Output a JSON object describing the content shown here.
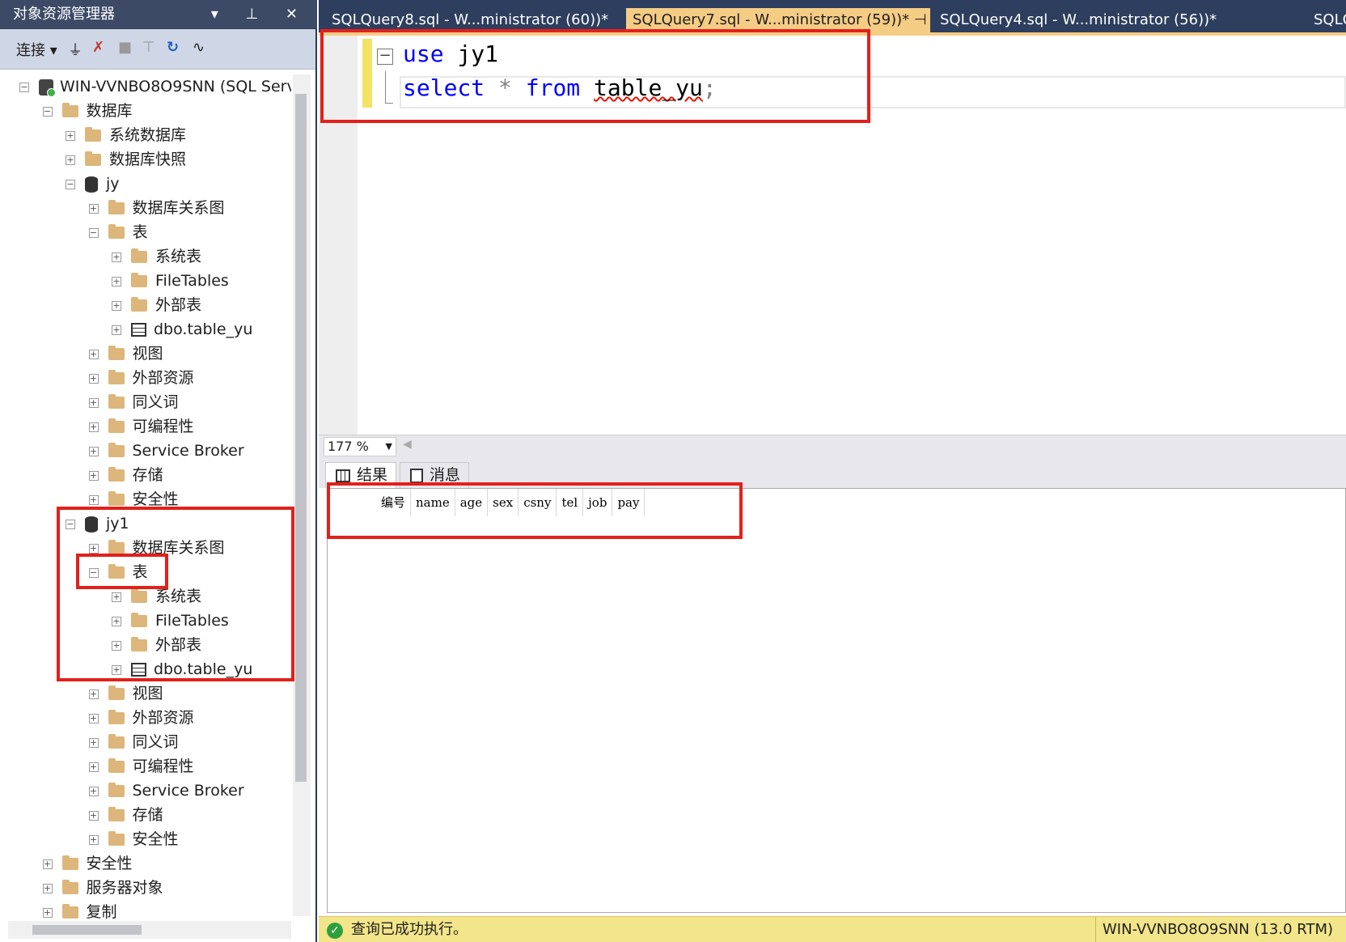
{
  "object_explorer": {
    "title": "对象资源管理器",
    "title_controls": "▾ ⊥ ✕",
    "toolbar": {
      "connect": "连接 ▾",
      "icons": [
        "⏚",
        "✗",
        "■",
        "⊤",
        "↻",
        "∿"
      ]
    },
    "tree": [
      {
        "label": "WIN-VVNBO8O9SNN (SQL Serv",
        "icon": "server",
        "exp": "−"
      },
      {
        "label": "数据库",
        "icon": "folder",
        "exp": "−"
      },
      {
        "label": "系统数据库",
        "icon": "folder",
        "exp": "+"
      },
      {
        "label": "数据库快照",
        "icon": "folder",
        "exp": "+"
      },
      {
        "label": "jy",
        "icon": "database",
        "exp": "−"
      },
      {
        "label": "数据库关系图",
        "icon": "folder",
        "exp": "+"
      },
      {
        "label": "表",
        "icon": "folder",
        "exp": "−"
      },
      {
        "label": "系统表",
        "icon": "folder",
        "exp": "+"
      },
      {
        "label": "FileTables",
        "icon": "folder",
        "exp": "+"
      },
      {
        "label": "外部表",
        "icon": "folder",
        "exp": "+"
      },
      {
        "label": "dbo.table_yu",
        "icon": "table",
        "exp": "+"
      },
      {
        "label": "视图",
        "icon": "folder",
        "exp": "+"
      },
      {
        "label": "外部资源",
        "icon": "folder",
        "exp": "+"
      },
      {
        "label": "同义词",
        "icon": "folder",
        "exp": "+"
      },
      {
        "label": "可编程性",
        "icon": "folder",
        "exp": "+"
      },
      {
        "label": "Service Broker",
        "icon": "folder",
        "exp": "+"
      },
      {
        "label": "存储",
        "icon": "folder",
        "exp": "+"
      },
      {
        "label": "安全性",
        "icon": "folder",
        "exp": "+"
      },
      {
        "label": "jy1",
        "icon": "database",
        "exp": "−"
      },
      {
        "label": "数据库关系图",
        "icon": "folder",
        "exp": "+"
      },
      {
        "label": "表",
        "icon": "folder",
        "exp": "−"
      },
      {
        "label": "系统表",
        "icon": "folder",
        "exp": "+"
      },
      {
        "label": "FileTables",
        "icon": "folder",
        "exp": "+"
      },
      {
        "label": "外部表",
        "icon": "folder",
        "exp": "+"
      },
      {
        "label": "dbo.table_yu",
        "icon": "table",
        "exp": "+"
      },
      {
        "label": "视图",
        "icon": "folder",
        "exp": "+"
      },
      {
        "label": "外部资源",
        "icon": "folder",
        "exp": "+"
      },
      {
        "label": "同义词",
        "icon": "folder",
        "exp": "+"
      },
      {
        "label": "可编程性",
        "icon": "folder",
        "exp": "+"
      },
      {
        "label": "Service Broker",
        "icon": "folder",
        "exp": "+"
      },
      {
        "label": "存储",
        "icon": "folder",
        "exp": "+"
      },
      {
        "label": "安全性",
        "icon": "folder",
        "exp": "+"
      },
      {
        "label": "安全性",
        "icon": "folder",
        "exp": "+"
      },
      {
        "label": "服务器对象",
        "icon": "folder",
        "exp": "+"
      },
      {
        "label": "复制",
        "icon": "folder",
        "exp": "+"
      }
    ]
  },
  "tabs": [
    {
      "label": "SQLQuery8.sql - W...ministrator (60))*",
      "active": false
    },
    {
      "label": "SQLQuery7.sql - W...ministrator (59))*  ⊣  ✕",
      "active": true
    },
    {
      "label": "SQLQuery4.sql - W...ministrator (56))*",
      "active": false
    },
    {
      "label": "SQLQ",
      "active": false
    }
  ],
  "editor": {
    "line1": {
      "kw": "use",
      "rest": " jy1"
    },
    "line2": {
      "kw1": "select",
      "op": " * ",
      "kw2": "from",
      "id": "table_yu",
      "end": ";"
    }
  },
  "zoom": "177 %",
  "results": {
    "tab_results": "结果",
    "tab_messages": "消息",
    "columns": [
      "编号",
      "name",
      "age",
      "sex",
      "csny",
      "tel",
      "job",
      "pay"
    ]
  },
  "status": {
    "message": "查询已成功执行。",
    "server": "WIN-VVNBO8O9SNN (13.0 RTM)"
  },
  "colors": {
    "highlight": "#e3201b",
    "status_bg": "#f3e58a",
    "tab_active": "#f5cc84"
  }
}
